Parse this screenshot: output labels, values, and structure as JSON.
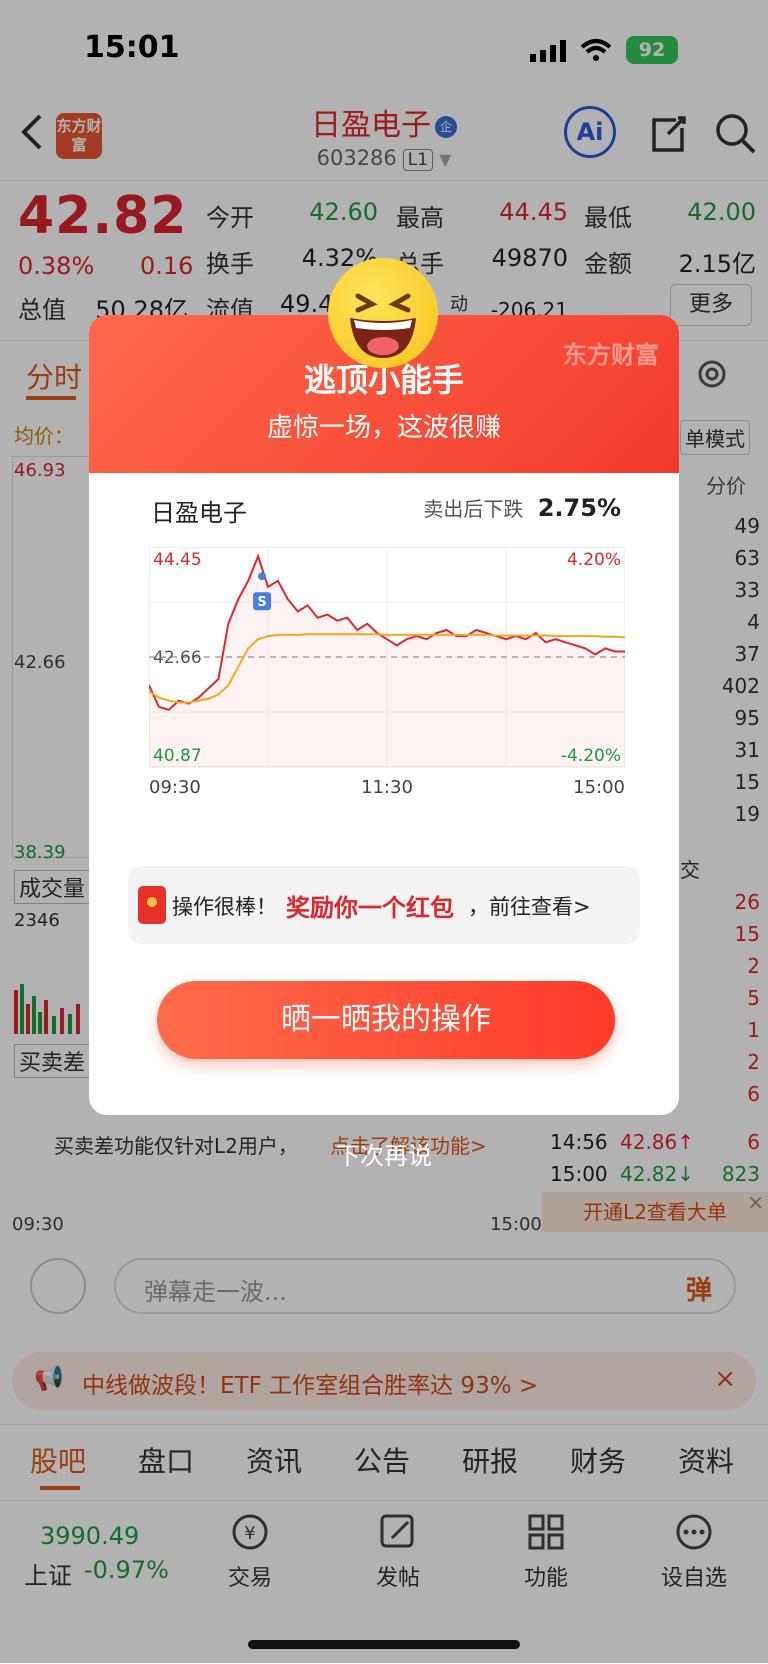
{
  "status_bar": {
    "time": "15:01",
    "battery": "92"
  },
  "header": {
    "stock_name": "日盈电子",
    "stock_code": "603286",
    "level_badge": "L1",
    "logo_text": "东方财富"
  },
  "quote": {
    "price": "42.82",
    "change_pct": "0.38%",
    "change": "0.16",
    "open_label": "今开",
    "open": "42.60",
    "high_label": "最高",
    "high": "44.45",
    "low_label": "最低",
    "low": "42.00",
    "turnover_label": "换手",
    "turnover": "4.32%",
    "volume_label": "总手",
    "volume": "49870",
    "amount_label": "金额",
    "amount": "2.15亿",
    "mktcap_label": "总值",
    "mktcap": "50.28亿",
    "float_label": "流值",
    "float": "49.4",
    "dyn_label": "动",
    "dyn_val": "-206.21",
    "more": "更多"
  },
  "bg": {
    "tab_minute": "分时",
    "avg_label": "均价：",
    "y_top": "46.93",
    "y_mid": "42.66",
    "y_bottom": "38.39",
    "vol_label": "成交量",
    "vol_val": "2346",
    "diff_label": "买卖差",
    "l2_notice": "买卖差功能仅针对L2用户，",
    "l2_link": "点击了解该功能>",
    "x_start": "09:30",
    "x_end": "15:00",
    "mode_btn": "单模式",
    "col_price": "分价",
    "depth": [
      "49",
      "63",
      "33",
      "4",
      "37",
      "402",
      "95",
      "31",
      "15",
      "19"
    ],
    "trade_header": "交",
    "trades": [
      "26",
      "15",
      "2",
      "5",
      "1",
      "2",
      "6"
    ],
    "tick_rows": [
      {
        "time": "14:56",
        "price": "42.86↑",
        "vol": "6"
      },
      {
        "time": "15:00",
        "price": "42.82↓",
        "vol": "823"
      }
    ],
    "l2_banner": "开通L2查看大单",
    "danmu_placeholder": "弹幕走一波...",
    "danmu_btn": "弹",
    "promo": "中线做波段！ETF 工作室组合胜率达 93% >"
  },
  "tabs": [
    "股吧",
    "盘口",
    "资讯",
    "公告",
    "研报",
    "财务",
    "资料"
  ],
  "bottom_nav": {
    "index_value": "3990.49",
    "index_label": "上证",
    "index_change": "-0.97%",
    "items": [
      "交易",
      "发帖",
      "功能",
      "设自选"
    ]
  },
  "modal": {
    "brand": "东方财富",
    "title": "逃顶小能手",
    "subtitle": "虚惊一场，这波很赚",
    "stock": "日盈电子",
    "after_label": "卖出后下跌",
    "after_value": "2.75%",
    "reward_prefix": "操作很棒！",
    "reward_highlight": "奖励你一个红包",
    "reward_suffix": "，前往查看>",
    "share_button": "晒一晒我的操作",
    "dismiss": "下次再说",
    "sell_marker": "S"
  },
  "chart_data": {
    "type": "line",
    "x_labels": [
      "09:30",
      "11:30",
      "15:00"
    ],
    "y_left": {
      "top": "44.45",
      "mid": "42.66",
      "bottom": "40.87"
    },
    "y_right": {
      "top": "4.20%",
      "bottom": "-4.20%"
    },
    "ylim": [
      40.87,
      44.45
    ],
    "prev_close": 42.66,
    "series": [
      {
        "values": [
          42.2,
          41.85,
          41.8,
          41.95,
          41.9,
          42.0,
          42.15,
          42.3,
          43.2,
          43.6,
          43.9,
          44.3,
          43.8,
          43.9,
          43.6,
          43.4,
          43.5,
          43.3,
          43.35,
          43.25,
          43.3,
          43.1,
          43.2,
          43.05,
          42.95,
          42.85,
          42.95,
          43.0,
          42.95,
          43.05,
          43.1,
          43.0,
          43.0,
          43.1,
          43.05,
          43.0,
          42.95,
          43.0,
          42.95,
          43.05,
          42.9,
          42.95,
          42.9,
          42.85,
          42.8,
          42.7,
          42.8,
          42.75,
          42.75
        ]
      },
      {
        "values": [
          42.1,
          42.0,
          41.95,
          41.92,
          41.92,
          41.95,
          41.98,
          42.05,
          42.2,
          42.5,
          42.8,
          42.95,
          43.0,
          43.02,
          43.02,
          43.02,
          43.03,
          43.03,
          43.03,
          43.03,
          43.03,
          43.03,
          43.03,
          43.03,
          43.02,
          43.02,
          43.02,
          43.02,
          43.02,
          43.02,
          43.02,
          43.02,
          43.02,
          43.02,
          43.02,
          43.01,
          43.01,
          43.01,
          43.01,
          43.01,
          43.01,
          43.0,
          43.0,
          43.0,
          43.0,
          43.0,
          42.99,
          42.99,
          42.98
        ]
      }
    ]
  },
  "colors": {
    "price_line": "#e0262d",
    "avg_line": "#f5a623",
    "accent": "#ff4a33"
  }
}
